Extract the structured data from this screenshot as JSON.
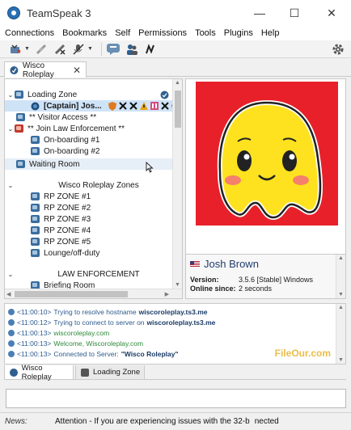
{
  "window": {
    "title": "TeamSpeak 3",
    "minimize": "—",
    "maximize": "☐",
    "close": "✕"
  },
  "menu": [
    "Connections",
    "Bookmarks",
    "Self",
    "Permissions",
    "Tools",
    "Plugins",
    "Help"
  ],
  "tabs": [
    {
      "label": "Wisco Roleplay",
      "close": "✕"
    }
  ],
  "tree": {
    "items": [
      {
        "label": "Loading Zone"
      },
      {
        "label": "[Captain] Jos..."
      },
      {
        "label": "** Visitor Access **"
      },
      {
        "label": "** Join Law Enforcement **"
      },
      {
        "label": "On-boarding #1"
      },
      {
        "label": "On-boarding #2"
      },
      {
        "label": "Waiting Room"
      },
      {
        "label": "Wisco Roleplay Zones"
      },
      {
        "label": "RP ZONE #1"
      },
      {
        "label": "RP ZONE #2"
      },
      {
        "label": "RP ZONE #3"
      },
      {
        "label": "RP ZONE #4"
      },
      {
        "label": "RP ZONE #5"
      },
      {
        "label": "Lounge/off-duty"
      },
      {
        "label": "LAW ENFORCEMENT"
      },
      {
        "label": "Briefing Room"
      }
    ]
  },
  "client_info": {
    "name": "Josh Brown",
    "version_label": "Version:",
    "version_value": "3.5.6 [Stable] Windows",
    "online_label": "Online since:",
    "online_value": "2 seconds"
  },
  "log": [
    {
      "time": "<11:00:10>",
      "msg": "Trying to resolve hostname",
      "bold": "wiscoroleplay.ts3.me",
      "color": "#2d5a8c"
    },
    {
      "time": "<11:00:12>",
      "msg": "Trying to connect to server on",
      "bold": "wiscoroleplay.ts3.me",
      "color": "#2d5a8c"
    },
    {
      "time": "<11:00:13>",
      "msg": "wiscoroleplay.com",
      "bold": "",
      "color": "#2e8b3a"
    },
    {
      "time": "<11:00:13>",
      "msg": "Welcome, Wiscoroleplay.com",
      "bold": "",
      "color": "#2e8b3a"
    },
    {
      "time": "<11:00:13>",
      "msg": "Connected to Server:",
      "bold": "\"Wisco Roleplay\"",
      "color": "#2d5a8c"
    }
  ],
  "bottom_tabs": [
    {
      "label": "Wisco Roleplay"
    },
    {
      "label": "Loading Zone"
    }
  ],
  "news": {
    "label": "News:",
    "text": "Attention - If you are experiencing issues with the 32-b",
    "text_tail": "nected"
  },
  "watermark": "FileOur.com"
}
